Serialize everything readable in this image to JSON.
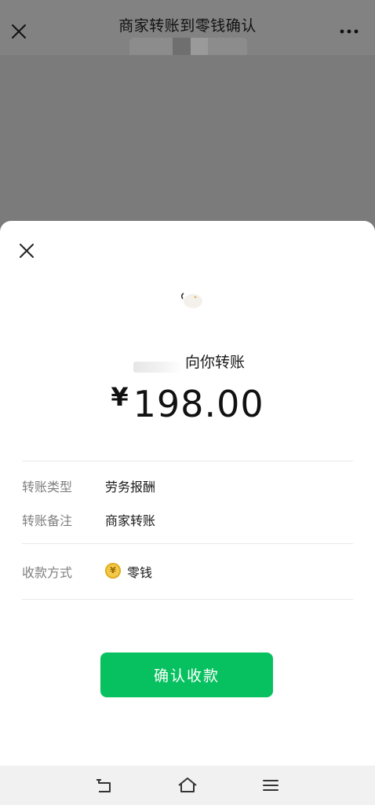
{
  "app_bar": {
    "title": "商家转账到零钱确认",
    "close_icon": "close-icon",
    "more_icon": "more-horizontal-icon"
  },
  "sheet": {
    "close_icon": "close-icon",
    "payer_suffix": "向你转账",
    "currency_symbol": "¥",
    "amount": "198.00",
    "details": [
      {
        "label": "转账类型",
        "value": "劳务报酬"
      },
      {
        "label": "转账备注",
        "value": "商家转账"
      }
    ],
    "payment_method": {
      "label": "收款方式",
      "value": "零钱",
      "icon": "change-coin-icon",
      "icon_glyph": "¥"
    },
    "confirm_label": "确认收款"
  },
  "colors": {
    "primary_green": "#07c160",
    "overlay_gray": "#7a7a7a",
    "coin_yellow": "#f2c94c"
  },
  "system_nav": {
    "back_icon": "back-icon",
    "home_icon": "home-icon",
    "menu_icon": "menu-icon"
  }
}
